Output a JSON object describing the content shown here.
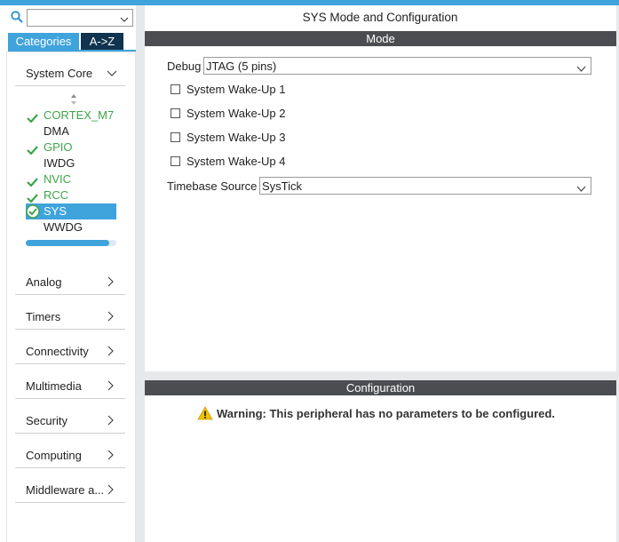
{
  "colors": {
    "accent": "#3fa3dc",
    "tab_dark": "#10344f",
    "section_bar": "#4b4d50",
    "enabled_green": "#3fa449",
    "warning_yellow": "#f2c200"
  },
  "search": {
    "value": "",
    "icon": "search-icon"
  },
  "tabs": {
    "categories": "Categories",
    "az": "A->Z"
  },
  "system_core": {
    "label": "System Core",
    "expanded": true,
    "peripherals": [
      {
        "name": "CORTEX_M7",
        "status": "configured"
      },
      {
        "name": "DMA",
        "status": "none"
      },
      {
        "name": "GPIO",
        "status": "configured"
      },
      {
        "name": "IWDG",
        "status": "none"
      },
      {
        "name": "NVIC",
        "status": "configured"
      },
      {
        "name": "RCC",
        "status": "configured"
      },
      {
        "name": "SYS",
        "status": "selected"
      },
      {
        "name": "WWDG",
        "status": "none"
      }
    ]
  },
  "categories": [
    {
      "label": "Analog"
    },
    {
      "label": "Timers"
    },
    {
      "label": "Connectivity"
    },
    {
      "label": "Multimedia"
    },
    {
      "label": "Security"
    },
    {
      "label": "Computing"
    },
    {
      "label": "Middleware a..."
    }
  ],
  "main": {
    "title": "SYS Mode and Configuration",
    "mode_header": "Mode",
    "debug": {
      "label": "Debug",
      "value": "JTAG (5 pins)"
    },
    "wakeups": [
      {
        "label": "System Wake-Up 1",
        "checked": false
      },
      {
        "label": "System Wake-Up 2",
        "checked": false
      },
      {
        "label": "System Wake-Up 3",
        "checked": false
      },
      {
        "label": "System Wake-Up 4",
        "checked": false
      }
    ],
    "timebase": {
      "label": "Timebase Source",
      "value": "SysTick"
    },
    "config_header": "Configuration",
    "warning": "Warning: This peripheral has no parameters to be configured."
  }
}
